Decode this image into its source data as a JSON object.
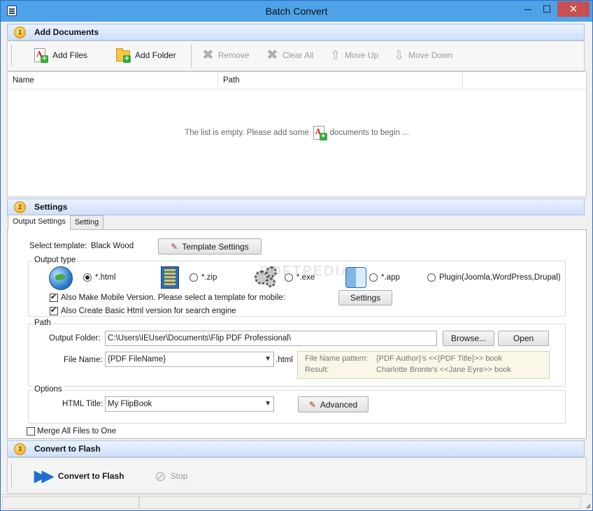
{
  "window": {
    "title": "Batch Convert",
    "min_symbol": "─",
    "max_symbol": "☐",
    "close_symbol": "✕"
  },
  "sections": {
    "add": {
      "number": "1",
      "title": "Add Documents"
    },
    "settings": {
      "number": "2",
      "title": "Settings"
    },
    "convert": {
      "number": "3",
      "title": "Convert to Flash"
    }
  },
  "toolbar": {
    "add_files": "Add Files",
    "add_folder": "Add Folder",
    "remove": "Remove",
    "clear_all": "Clear All",
    "move_up": "Move Up",
    "move_down": "Move Down"
  },
  "list": {
    "columns": [
      "Name",
      "Path"
    ],
    "empty_prefix": "The list is empty. Please add some",
    "empty_suffix": "documents to begin ..."
  },
  "tabs": [
    "Output Settings",
    "Setting"
  ],
  "template": {
    "label": "Select template:",
    "value": "Black Wood",
    "button": "Template Settings"
  },
  "output_type": {
    "label": "Output type",
    "options": [
      "*.html",
      "*.zip",
      "*.exe",
      "*.app",
      "Plugin(Joomla,WordPress,Drupal)"
    ],
    "selected": "*.html",
    "mobile_check": "Also Make Mobile Version. Please select a template for mobile:",
    "basic_check": "Also Create Basic Html version for search engine",
    "settings_button": "Settings"
  },
  "path": {
    "label": "Path",
    "output_folder_label": "Output Folder:",
    "output_folder_value": "C:\\Users\\IEUser\\Documents\\Flip PDF Professional\\",
    "browse_button": "Browse...",
    "open_button": "Open",
    "file_name_label": "File Name:",
    "file_name_value": "{PDF FileName}",
    "extension": ".html",
    "pattern_label": "File Name pattern:",
    "pattern_value": "{PDF Author}'s <<{PDF Title}>> book",
    "result_label": "Result:",
    "result_value": "Charlotte Bronte's <<Jane Eyre>> book"
  },
  "options": {
    "label": "Options",
    "html_title_label": "HTML Title:",
    "html_title_value": "My FlipBook",
    "advanced_button": "Advanced"
  },
  "merge_label": "Merge All Files to One",
  "convert": {
    "convert_button": "Convert to Flash",
    "stop_button": "Stop"
  },
  "watermark": "SOFTPEDIA",
  "colors": {
    "titlebar": "#4ea2e8",
    "close": "#c75050",
    "header_gradient_end": "#cfe0fb",
    "convert_icon": "#1f6fd1"
  }
}
